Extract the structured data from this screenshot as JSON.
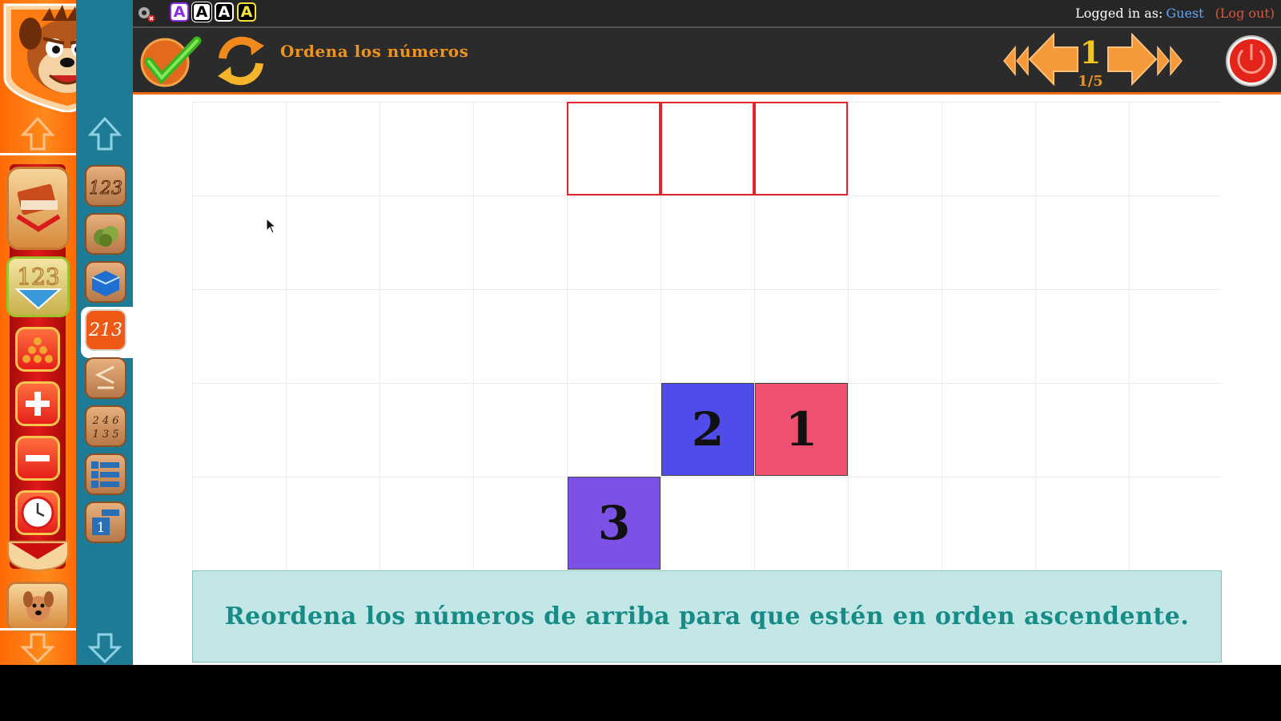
{
  "header": {
    "login_label": "Logged in as:",
    "user_name": "Guest",
    "logout_label": "(Log out)",
    "font_buttons": [
      "A",
      "A",
      "A",
      "A"
    ]
  },
  "toolbar": {
    "title": "Ordena los números",
    "level": "1",
    "level_progress": "1/5"
  },
  "sidebar_right": {
    "active_item": "213"
  },
  "board": {
    "target_slots": 3,
    "tiles": [
      {
        "value": "3",
        "color": "#7c52e6"
      },
      {
        "value": "2",
        "color": "#4f4cea"
      },
      {
        "value": "1",
        "color": "#ee5072"
      }
    ]
  },
  "instruction": "Reordena los números de arriba para que estén en orden ascendente.",
  "colors": {
    "accent_orange": "#ef6a12",
    "title_orange": "#f0921f",
    "level_yellow": "#f3c617",
    "sidebar_blue": "#1d7b95",
    "slot_red": "#e3262d",
    "instruction_bg": "#c3e7e7",
    "instruction_text": "#178c87"
  },
  "icons": {
    "toolbar": [
      "check-icon",
      "refresh-icon",
      "first-icon",
      "previous-icon",
      "next-icon",
      "last-icon",
      "power-icon"
    ],
    "sidebar_left": [
      "mascot-dog-icon",
      "up-arrow-icon",
      "books-icon",
      "numbers-icon",
      "balls-icon",
      "plus-icon",
      "minus-icon",
      "clock-icon",
      "dog-icon",
      "down-arrow-icon"
    ],
    "sidebar_right": [
      "up-arrow-icon",
      "numbers-123-icon",
      "apples-icon",
      "basket-icon",
      "reorder-213-icon",
      "less-equal-icon",
      "odd-even-icon",
      "number-list-icon",
      "number-card-icon",
      "down-arrow-icon"
    ]
  }
}
